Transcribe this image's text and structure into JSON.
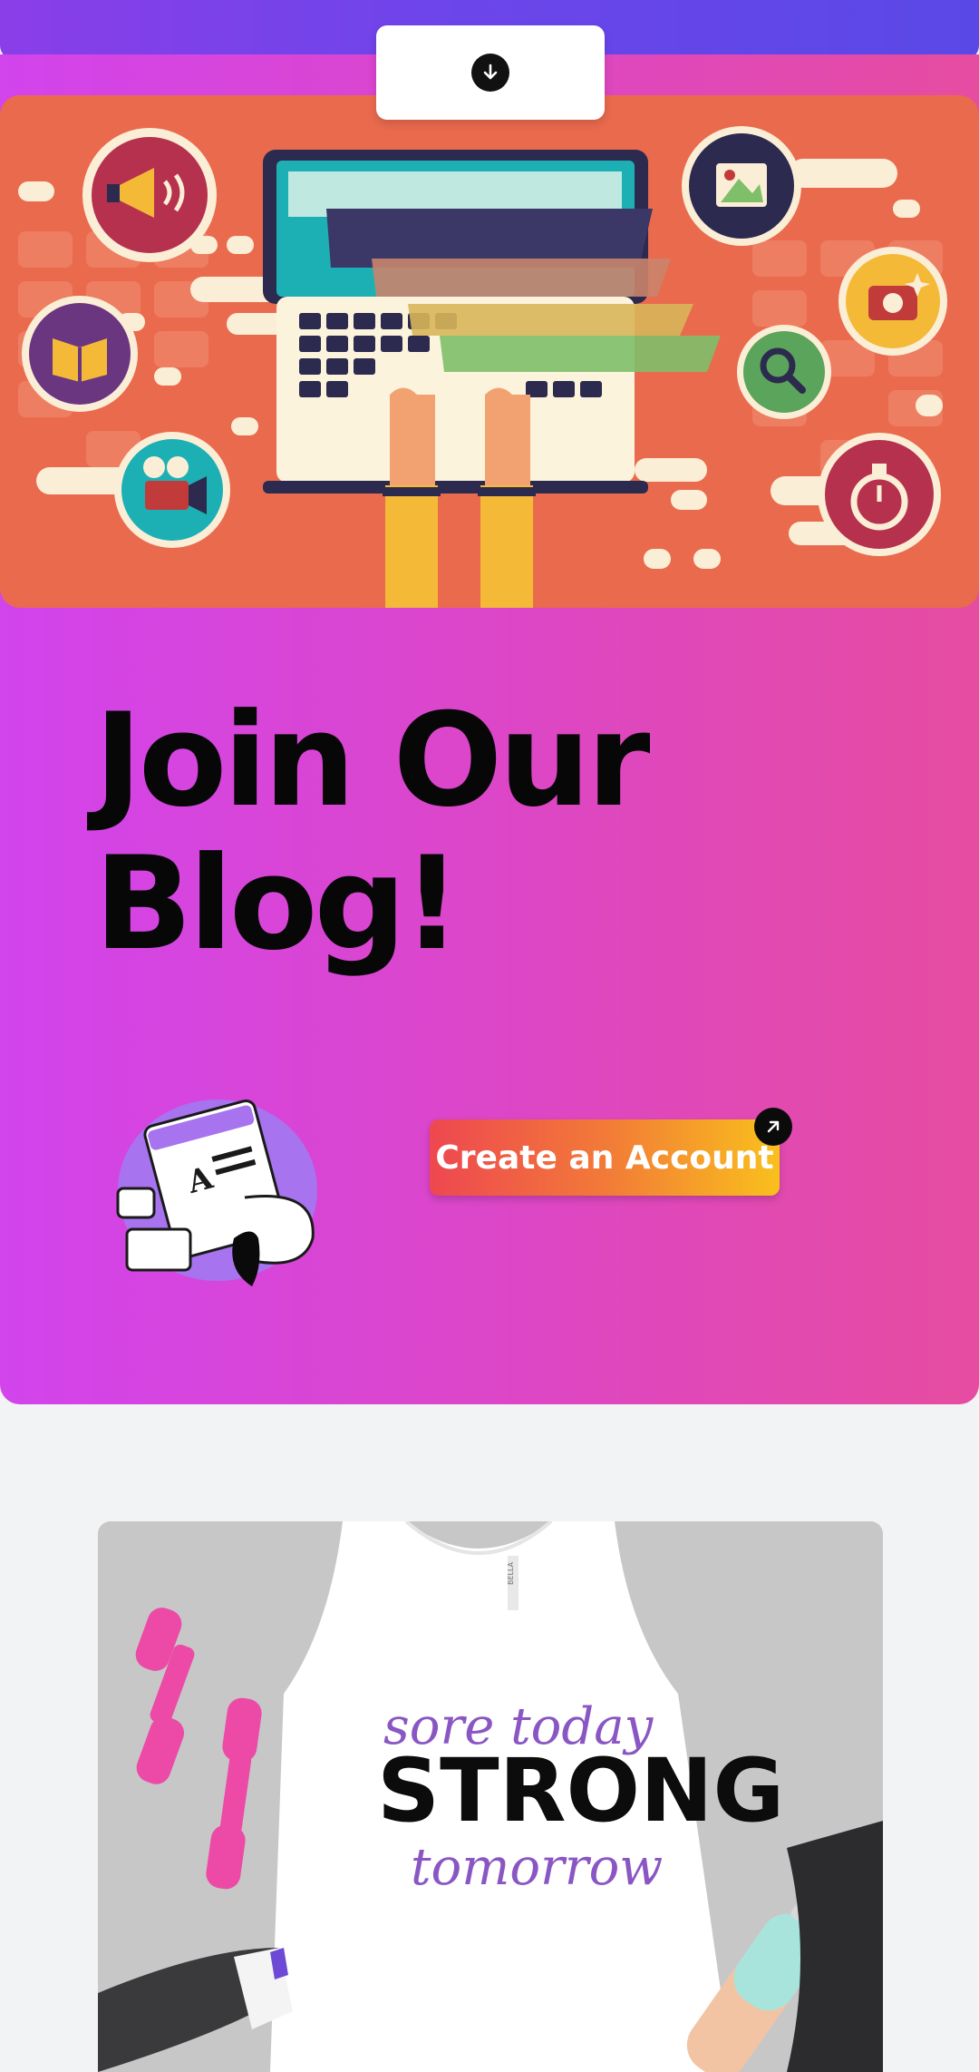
{
  "page": {
    "headline": "Join Our Blog!",
    "cta_label": "Create an Account"
  },
  "colors": {
    "accent_purple": "#6d45ea",
    "card_pink": "#dc46c8",
    "cta_start": "#ee4750",
    "cta_end": "#f9c01c",
    "hero_orange": "#ea6a4e"
  },
  "icons": {
    "scroll": "arrow-down-circle-icon",
    "cta_badge": "arrow-up-right-icon"
  },
  "product": {
    "line1": "sore today",
    "line2": "STRONG",
    "line3": "tomorrow",
    "tag": "BELLA"
  }
}
